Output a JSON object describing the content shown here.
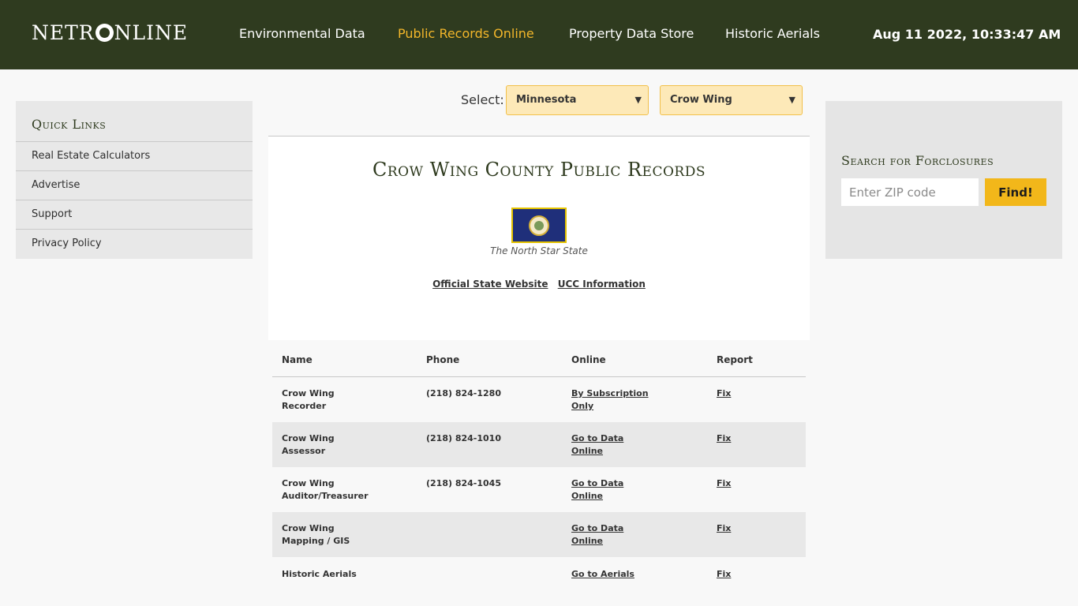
{
  "header": {
    "logo_left": "NETR",
    "logo_right": "NLINE",
    "nav": [
      {
        "label": "Environmental Data"
      },
      {
        "label": "Public Records Online"
      },
      {
        "label": "Property Data Store"
      },
      {
        "label": "Historic Aerials"
      }
    ],
    "clock": "Aug 11 2022, 10:33:47 AM"
  },
  "quick_links": {
    "title": "Quick Links",
    "items": [
      {
        "label": "Real Estate Calculators"
      },
      {
        "label": "Advertise"
      },
      {
        "label": "Support"
      },
      {
        "label": "Privacy Policy"
      }
    ]
  },
  "selector": {
    "label": "Select:",
    "state": "Minnesota",
    "county": "Crow Wing"
  },
  "main": {
    "title": "Crow Wing County Public Records",
    "motto": "The North Star State",
    "links": [
      {
        "label": "Official State Website"
      },
      {
        "label": "UCC Information"
      }
    ]
  },
  "foreclosure": {
    "title": "Search for Forclosures",
    "placeholder": "Enter ZIP code",
    "button": "Find!"
  },
  "table": {
    "columns": [
      "Name",
      "Phone",
      "Online",
      "Report"
    ],
    "rows": [
      {
        "name1": "Crow Wing",
        "name2": "Recorder",
        "phone": "(218) 824-1280",
        "online1": "By Subscription",
        "online2": "Only",
        "report": "Fix"
      },
      {
        "name1": "Crow Wing",
        "name2": "Assessor",
        "phone": "(218) 824-1010",
        "online1": "Go to Data",
        "online2": "Online",
        "report": "Fix"
      },
      {
        "name1": "Crow Wing",
        "name2": "Auditor/Treasurer",
        "phone": "(218) 824-1045",
        "online1": "Go to Data",
        "online2": "Online",
        "report": "Fix"
      },
      {
        "name1": "Crow Wing",
        "name2": "Mapping / GIS",
        "phone": "",
        "online1": "Go to Data",
        "online2": "Online",
        "report": "Fix"
      },
      {
        "name1": "Historic Aerials",
        "name2": "",
        "phone": "",
        "online1": "Go to Aerials",
        "online2": "",
        "report": "Fix"
      }
    ]
  },
  "colors": {
    "header_bg": "#2f3b1f",
    "accent": "#f2b62a"
  }
}
